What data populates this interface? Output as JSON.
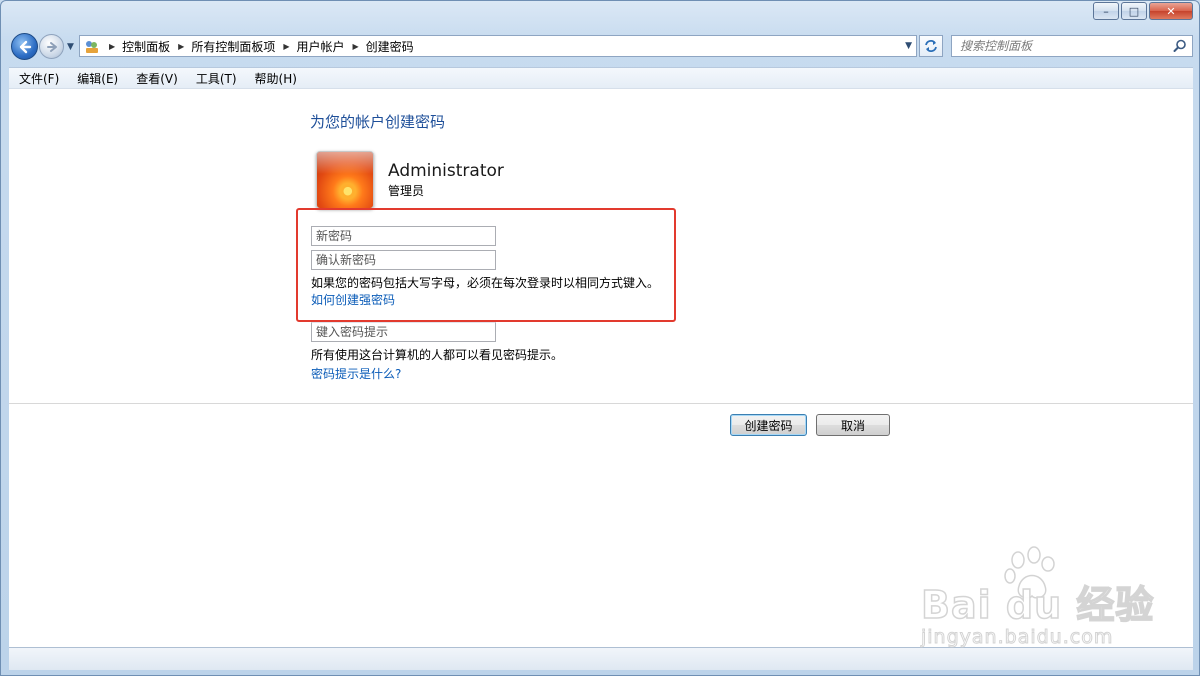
{
  "window": {
    "caption_buttons": {
      "minimize": "–",
      "maximize": "□",
      "close": "✕"
    }
  },
  "nav": {
    "back_icon": "back-arrow-icon",
    "forward_icon": "forward-arrow-icon",
    "breadcrumbs": [
      "控制面板",
      "所有控制面板项",
      "用户帐户",
      "创建密码"
    ],
    "search_placeholder": "搜索控制面板"
  },
  "menubar": {
    "items": [
      "文件(F)",
      "编辑(E)",
      "查看(V)",
      "工具(T)",
      "帮助(H)"
    ]
  },
  "page": {
    "heading": "为您的帐户创建密码",
    "user": {
      "name": "Administrator",
      "role": "管理员"
    },
    "new_password_placeholder": "新密码",
    "confirm_password_placeholder": "确认新密码",
    "case_note": "如果您的密码包括大写字母，必须在每次登录时以相同方式键入。",
    "strong_password_link": "如何创建强密码",
    "hint_placeholder": "键入密码提示",
    "hint_note": "所有使用这台计算机的人都可以看见密码提示。",
    "hint_link": "密码提示是什么?",
    "create_button": "创建密码",
    "cancel_button": "取消"
  },
  "watermark": {
    "logo": "Bai du 经验",
    "url": "jingyan.baidu.com"
  },
  "colors": {
    "accent": "#1e4f99",
    "link": "#0b5cb8",
    "highlight": "#e23a2e"
  }
}
